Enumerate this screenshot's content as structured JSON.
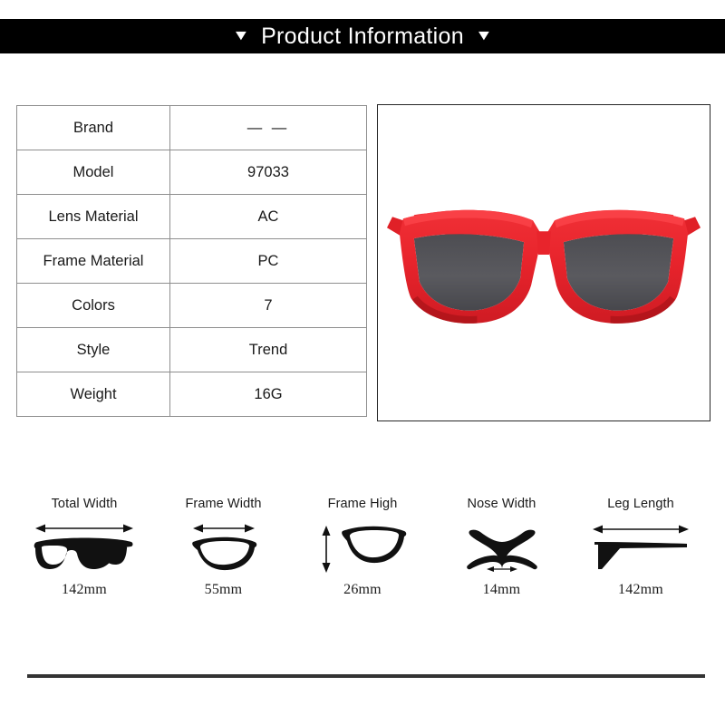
{
  "header": {
    "title": "Product Information",
    "left_marker": "▼",
    "right_marker": "▼",
    "background_color": "#000000",
    "text_color": "#ffffff"
  },
  "spec_table": {
    "rows": [
      {
        "label": "Brand",
        "value": "— —"
      },
      {
        "label": "Model",
        "value": "97033"
      },
      {
        "label": "Lens Material",
        "value": "AC"
      },
      {
        "label": "Frame Material",
        "value": "PC"
      },
      {
        "label": "Colors",
        "value": "7"
      },
      {
        "label": "Style",
        "value": "Trend"
      },
      {
        "label": "Weight",
        "value": "16G"
      }
    ]
  },
  "product_image": {
    "alt": "red cat-eye sunglasses front view",
    "frame_color": "#e8242c",
    "frame_shadow_color": "#b3151c",
    "lens_color": "#55555a",
    "background_color": "#ffffff"
  },
  "measurements": [
    {
      "label": "Total Width",
      "value": "142mm",
      "icon": "glasses-full-icon",
      "arrow": "horizontal"
    },
    {
      "label": "Frame Width",
      "value": "55mm",
      "icon": "lens-single-icon",
      "arrow": "horizontal"
    },
    {
      "label": "Frame High",
      "value": "26mm",
      "icon": "lens-height-icon",
      "arrow": "vertical"
    },
    {
      "label": "Nose Width",
      "value": "14mm",
      "icon": "nose-bridge-icon",
      "arrow": "horizontal-small"
    },
    {
      "label": "Leg Length",
      "value": "142mm",
      "icon": "temple-arm-icon",
      "arrow": "horizontal"
    }
  ],
  "footer": {
    "rule_color": "#333333"
  }
}
